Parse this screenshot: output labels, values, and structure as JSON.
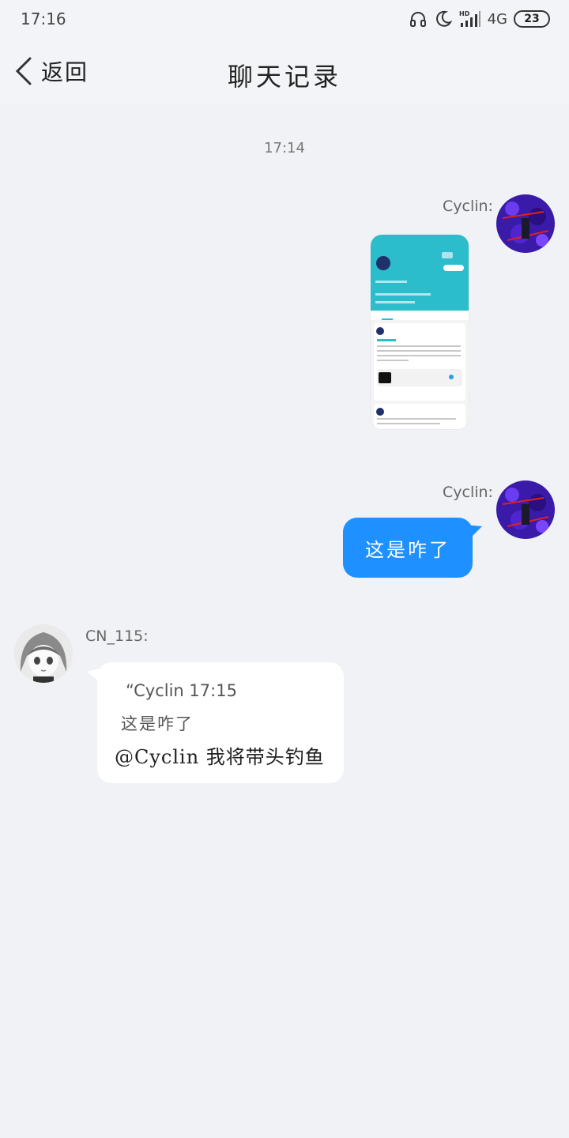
{
  "status_bar": {
    "time": "17:16",
    "network": "4G",
    "battery": "23",
    "icons": [
      "headphones-icon",
      "moon-icon",
      "hd-signal-icon"
    ]
  },
  "navbar": {
    "back_label": "返回",
    "title": "聊天记录"
  },
  "chat": {
    "timestamp": "17:14",
    "messages": [
      {
        "sender": "Cyclin:",
        "type": "image",
        "side": "right"
      },
      {
        "sender": "Cyclin:",
        "type": "text",
        "side": "right",
        "text": "这是咋了"
      },
      {
        "sender": "CN_115:",
        "type": "reply",
        "side": "left",
        "quote_meta": "“Cyclin 17:15",
        "quote_text": "这是咋了",
        "text": "@Cyclin 我将带头钓鱼"
      }
    ]
  },
  "colors": {
    "background": "#f0f2f5",
    "bubble_blue": "#1e90ff",
    "bubble_white": "#ffffff",
    "image_header": "#2bbdcc"
  }
}
